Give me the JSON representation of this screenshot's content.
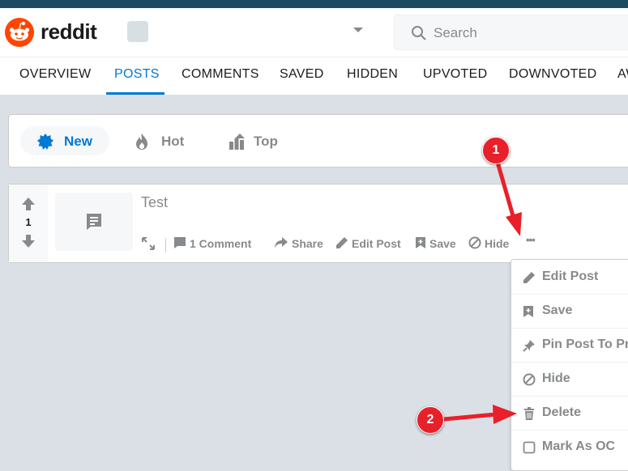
{
  "app": {
    "wordmark": "reddit"
  },
  "header": {
    "search_placeholder": "Search"
  },
  "tabs": [
    "OVERVIEW",
    "POSTS",
    "COMMENTS",
    "SAVED",
    "HIDDEN",
    "UPVOTED",
    "DOWNVOTED",
    "AW"
  ],
  "active_tab": "POSTS",
  "sort": {
    "new": "New",
    "hot": "Hot",
    "top": "Top"
  },
  "post": {
    "score": "1",
    "title": "Test",
    "actions": {
      "comment": "1 Comment",
      "share": "Share",
      "edit": "Edit Post",
      "save": "Save",
      "hide": "Hide",
      "more": "•••"
    }
  },
  "menu": [
    "Edit Post",
    "Save",
    "Pin Post To Profile",
    "Hide",
    "Delete",
    "Mark As OC"
  ],
  "annotations": {
    "step1": "1",
    "step2": "2"
  },
  "colors": {
    "brand": "#ff4500",
    "accent": "#0079d3",
    "annotation": "#e8202a"
  }
}
